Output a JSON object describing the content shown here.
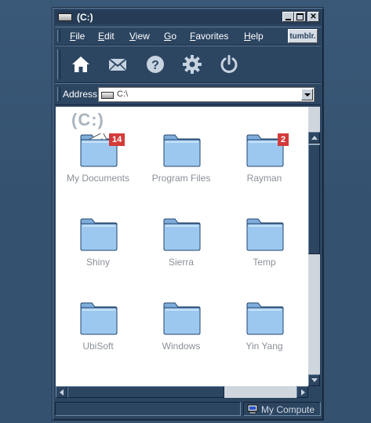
{
  "window": {
    "title": "(C:)"
  },
  "menu": [
    "File",
    "Edit",
    "View",
    "Go",
    "Favorites",
    "Help"
  ],
  "brand_button": "tumblr.",
  "toolbar": {
    "buttons": [
      "home-icon",
      "mail-icon",
      "help-icon",
      "gear-icon",
      "power-icon"
    ]
  },
  "address": {
    "label": "Address",
    "value": "C:\\"
  },
  "content": {
    "heading": "(C:)",
    "items": [
      {
        "name": "My Documents",
        "badge": "14"
      },
      {
        "name": "Program Files",
        "badge": ""
      },
      {
        "name": "Rayman",
        "badge": "2"
      },
      {
        "name": "Shiny",
        "badge": ""
      },
      {
        "name": "Sierra",
        "badge": ""
      },
      {
        "name": "Temp",
        "badge": ""
      },
      {
        "name": "UbiSoft",
        "badge": ""
      },
      {
        "name": "Windows",
        "badge": ""
      },
      {
        "name": "Yin Yang",
        "badge": ""
      }
    ]
  },
  "status": {
    "location": "My Compute"
  },
  "colors": {
    "background": "#34516f",
    "chrome": "#2c4561",
    "badge": "#d43a3a",
    "folder": "#9cc8f0"
  }
}
